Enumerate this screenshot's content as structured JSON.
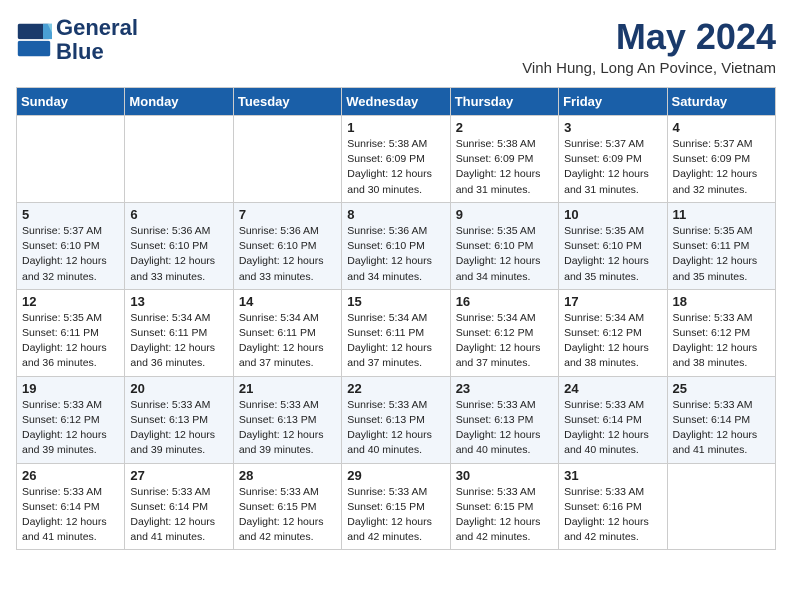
{
  "header": {
    "logo_line1": "General",
    "logo_line2": "Blue",
    "month": "May 2024",
    "location": "Vinh Hung, Long An Povince, Vietnam"
  },
  "days_of_week": [
    "Sunday",
    "Monday",
    "Tuesday",
    "Wednesday",
    "Thursday",
    "Friday",
    "Saturday"
  ],
  "weeks": [
    [
      {
        "day": "",
        "info": ""
      },
      {
        "day": "",
        "info": ""
      },
      {
        "day": "",
        "info": ""
      },
      {
        "day": "1",
        "info": "Sunrise: 5:38 AM\nSunset: 6:09 PM\nDaylight: 12 hours\nand 30 minutes."
      },
      {
        "day": "2",
        "info": "Sunrise: 5:38 AM\nSunset: 6:09 PM\nDaylight: 12 hours\nand 31 minutes."
      },
      {
        "day": "3",
        "info": "Sunrise: 5:37 AM\nSunset: 6:09 PM\nDaylight: 12 hours\nand 31 minutes."
      },
      {
        "day": "4",
        "info": "Sunrise: 5:37 AM\nSunset: 6:09 PM\nDaylight: 12 hours\nand 32 minutes."
      }
    ],
    [
      {
        "day": "5",
        "info": "Sunrise: 5:37 AM\nSunset: 6:10 PM\nDaylight: 12 hours\nand 32 minutes."
      },
      {
        "day": "6",
        "info": "Sunrise: 5:36 AM\nSunset: 6:10 PM\nDaylight: 12 hours\nand 33 minutes."
      },
      {
        "day": "7",
        "info": "Sunrise: 5:36 AM\nSunset: 6:10 PM\nDaylight: 12 hours\nand 33 minutes."
      },
      {
        "day": "8",
        "info": "Sunrise: 5:36 AM\nSunset: 6:10 PM\nDaylight: 12 hours\nand 34 minutes."
      },
      {
        "day": "9",
        "info": "Sunrise: 5:35 AM\nSunset: 6:10 PM\nDaylight: 12 hours\nand 34 minutes."
      },
      {
        "day": "10",
        "info": "Sunrise: 5:35 AM\nSunset: 6:10 PM\nDaylight: 12 hours\nand 35 minutes."
      },
      {
        "day": "11",
        "info": "Sunrise: 5:35 AM\nSunset: 6:11 PM\nDaylight: 12 hours\nand 35 minutes."
      }
    ],
    [
      {
        "day": "12",
        "info": "Sunrise: 5:35 AM\nSunset: 6:11 PM\nDaylight: 12 hours\nand 36 minutes."
      },
      {
        "day": "13",
        "info": "Sunrise: 5:34 AM\nSunset: 6:11 PM\nDaylight: 12 hours\nand 36 minutes."
      },
      {
        "day": "14",
        "info": "Sunrise: 5:34 AM\nSunset: 6:11 PM\nDaylight: 12 hours\nand 37 minutes."
      },
      {
        "day": "15",
        "info": "Sunrise: 5:34 AM\nSunset: 6:11 PM\nDaylight: 12 hours\nand 37 minutes."
      },
      {
        "day": "16",
        "info": "Sunrise: 5:34 AM\nSunset: 6:12 PM\nDaylight: 12 hours\nand 37 minutes."
      },
      {
        "day": "17",
        "info": "Sunrise: 5:34 AM\nSunset: 6:12 PM\nDaylight: 12 hours\nand 38 minutes."
      },
      {
        "day": "18",
        "info": "Sunrise: 5:33 AM\nSunset: 6:12 PM\nDaylight: 12 hours\nand 38 minutes."
      }
    ],
    [
      {
        "day": "19",
        "info": "Sunrise: 5:33 AM\nSunset: 6:12 PM\nDaylight: 12 hours\nand 39 minutes."
      },
      {
        "day": "20",
        "info": "Sunrise: 5:33 AM\nSunset: 6:13 PM\nDaylight: 12 hours\nand 39 minutes."
      },
      {
        "day": "21",
        "info": "Sunrise: 5:33 AM\nSunset: 6:13 PM\nDaylight: 12 hours\nand 39 minutes."
      },
      {
        "day": "22",
        "info": "Sunrise: 5:33 AM\nSunset: 6:13 PM\nDaylight: 12 hours\nand 40 minutes."
      },
      {
        "day": "23",
        "info": "Sunrise: 5:33 AM\nSunset: 6:13 PM\nDaylight: 12 hours\nand 40 minutes."
      },
      {
        "day": "24",
        "info": "Sunrise: 5:33 AM\nSunset: 6:14 PM\nDaylight: 12 hours\nand 40 minutes."
      },
      {
        "day": "25",
        "info": "Sunrise: 5:33 AM\nSunset: 6:14 PM\nDaylight: 12 hours\nand 41 minutes."
      }
    ],
    [
      {
        "day": "26",
        "info": "Sunrise: 5:33 AM\nSunset: 6:14 PM\nDaylight: 12 hours\nand 41 minutes."
      },
      {
        "day": "27",
        "info": "Sunrise: 5:33 AM\nSunset: 6:14 PM\nDaylight: 12 hours\nand 41 minutes."
      },
      {
        "day": "28",
        "info": "Sunrise: 5:33 AM\nSunset: 6:15 PM\nDaylight: 12 hours\nand 42 minutes."
      },
      {
        "day": "29",
        "info": "Sunrise: 5:33 AM\nSunset: 6:15 PM\nDaylight: 12 hours\nand 42 minutes."
      },
      {
        "day": "30",
        "info": "Sunrise: 5:33 AM\nSunset: 6:15 PM\nDaylight: 12 hours\nand 42 minutes."
      },
      {
        "day": "31",
        "info": "Sunrise: 5:33 AM\nSunset: 6:16 PM\nDaylight: 12 hours\nand 42 minutes."
      },
      {
        "day": "",
        "info": ""
      }
    ]
  ]
}
